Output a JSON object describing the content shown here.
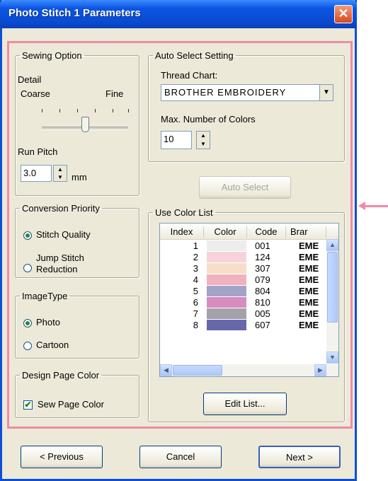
{
  "window": {
    "title": "Photo Stitch 1 Parameters",
    "close_glyph": "✕"
  },
  "sewing_option": {
    "legend": "Sewing Option",
    "detail_label": "Detail",
    "coarse_label": "Coarse",
    "fine_label": "Fine",
    "detail_level_fraction": 0.5,
    "run_pitch_label": "Run Pitch",
    "run_pitch_value": "3.0",
    "run_pitch_unit": "mm"
  },
  "conversion_priority": {
    "legend": "Conversion Priority",
    "options": [
      {
        "label": "Stitch Quality",
        "selected": true
      },
      {
        "label": "Jump Stitch Reduction",
        "selected": false
      }
    ]
  },
  "image_type": {
    "legend": "ImageType",
    "options": [
      {
        "label": "Photo",
        "selected": true
      },
      {
        "label": "Cartoon",
        "selected": false
      }
    ]
  },
  "design_page_color": {
    "legend": "Design Page Color",
    "sew_page_color_label": "Sew Page Color",
    "sew_page_color_checked": true
  },
  "auto_select": {
    "legend": "Auto Select Setting",
    "thread_chart_label": "Thread Chart:",
    "thread_chart_value": "BROTHER EMBROIDERY",
    "max_colors_label": "Max. Number of Colors",
    "max_colors_value": "10",
    "auto_select_button": "Auto Select"
  },
  "use_color_list": {
    "legend": "Use Color List",
    "columns": [
      "Index",
      "Color",
      "Code",
      "Brar"
    ],
    "rows": [
      {
        "index": "1",
        "color": "#ededee",
        "code": "001",
        "brand": "EME"
      },
      {
        "index": "2",
        "color": "#f6d3da",
        "code": "124",
        "brand": "EME"
      },
      {
        "index": "3",
        "color": "#f7deca",
        "code": "307",
        "brand": "EME"
      },
      {
        "index": "4",
        "color": "#f1b2c0",
        "code": "079",
        "brand": "EME"
      },
      {
        "index": "5",
        "color": "#a3a3c8",
        "code": "804",
        "brand": "EME"
      },
      {
        "index": "6",
        "color": "#d78cc0",
        "code": "810",
        "brand": "EME"
      },
      {
        "index": "7",
        "color": "#a2a2a8",
        "code": "005",
        "brand": "EME"
      },
      {
        "index": "8",
        "color": "#6767ac",
        "code": "607",
        "brand": "EME"
      }
    ],
    "edit_list_button": "Edit List..."
  },
  "footer": {
    "previous": "< Previous",
    "cancel": "Cancel",
    "next": "Next >"
  },
  "colors": {
    "title_bar": "#0b55e3",
    "highlight_frame": "#f08aa6",
    "dialog_bg": "#ece9d8"
  }
}
